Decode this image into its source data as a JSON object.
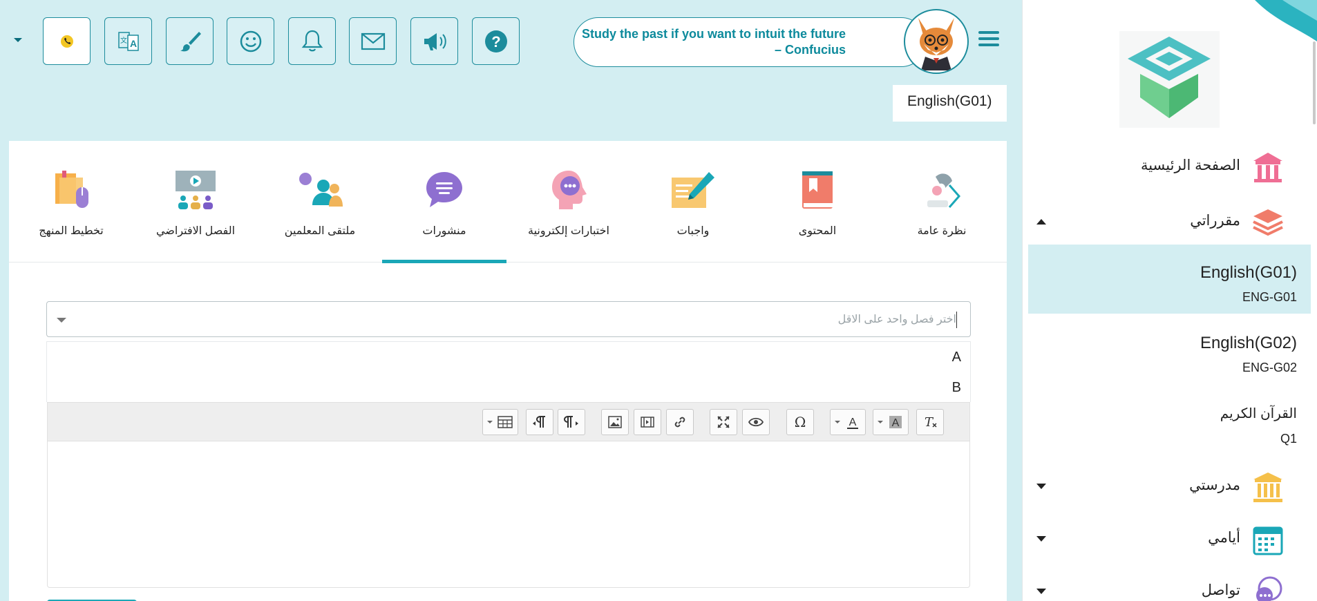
{
  "header": {
    "quote": "Study the past if you want to intuit the future – Confucius",
    "course_chip": "English(G01)",
    "toolbar_icons": [
      "phone-icon",
      "translate-icon",
      "paint-brush-icon",
      "smiley-icon",
      "bell-icon",
      "mail-icon",
      "megaphone-icon",
      "help-icon"
    ]
  },
  "tabs": [
    {
      "label": "نظرة عامة",
      "icon": "overview-icon"
    },
    {
      "label": "المحتوى",
      "icon": "book-icon"
    },
    {
      "label": "واجبات",
      "icon": "homework-icon"
    },
    {
      "label": "اختبارات إلكترونية",
      "icon": "quiz-icon"
    },
    {
      "label": "منشورات",
      "icon": "posts-icon",
      "active": true
    },
    {
      "label": "ملتقى المعلمين",
      "icon": "teachers-icon"
    },
    {
      "label": "الفصل الافتراضي",
      "icon": "virtual-class-icon"
    },
    {
      "label": "تخطيط المنهج",
      "icon": "curriculum-icon"
    }
  ],
  "class_select": {
    "placeholder": "اختر فصل واحد على الاقل",
    "options": [
      "A",
      "B"
    ]
  },
  "editor": {
    "buttons": [
      "clear-format",
      "highlight-color",
      "text-color",
      "special-char",
      "preview",
      "fullscreen",
      "link",
      "video",
      "image",
      "paragraph-ltr",
      "paragraph-rtl",
      "table"
    ]
  },
  "sidebar": {
    "home": "الصفحة الرئيسية",
    "my_courses": "مقرراتي",
    "courses": [
      {
        "name": "English(G01)",
        "code": "ENG-G01",
        "active": true
      },
      {
        "name": "English(G02)",
        "code": "ENG-G02"
      },
      {
        "name": "القرآن الكريم",
        "code": "Q1"
      }
    ],
    "my_school": "مدرستي",
    "my_days": "أيامي",
    "communication": "تواصل"
  },
  "colors": {
    "accent": "#1aa7b7",
    "background": "#d3eef2",
    "quote_text": "#0d8a9c"
  }
}
